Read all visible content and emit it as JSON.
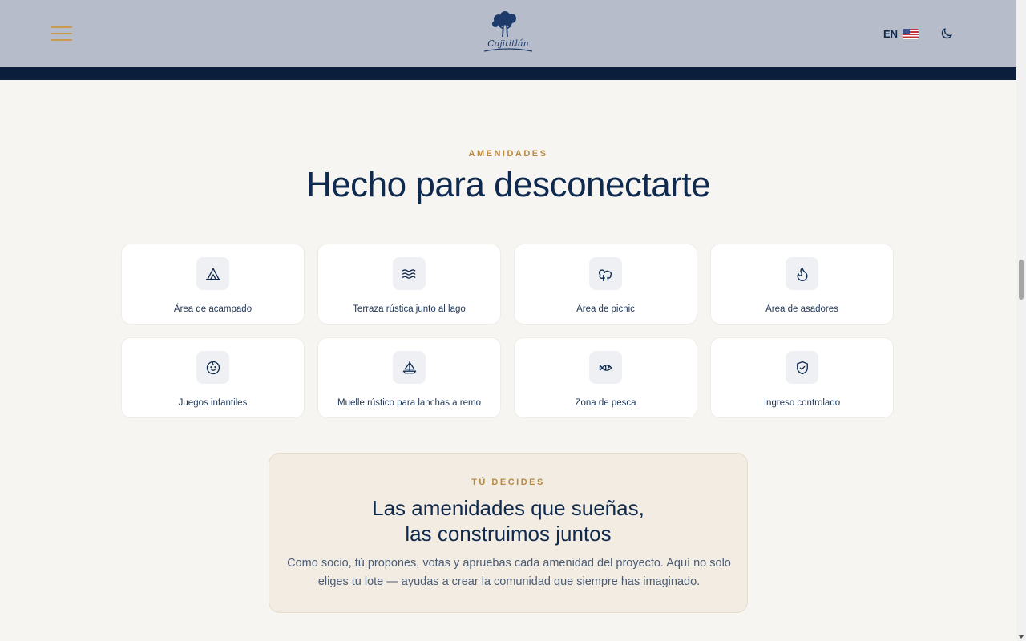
{
  "header": {
    "language_label": "EN",
    "logo_text": "Cajititlán",
    "colors": {
      "header_bg": "#b6bcc9",
      "header_bar": "#0b1f3d",
      "accent": "#c99a4b"
    }
  },
  "amenities": {
    "eyebrow": "AMENIDADES",
    "title": "Hecho para desconectarte",
    "items": [
      {
        "label": "Área de acampado",
        "icon": "tent-icon"
      },
      {
        "label": "Terraza rústica junto al lago",
        "icon": "waves-icon"
      },
      {
        "label": "Área de picnic",
        "icon": "trees-icon"
      },
      {
        "label": "Área de asadores",
        "icon": "flame-icon"
      },
      {
        "label": "Juegos infantiles",
        "icon": "baby-icon"
      },
      {
        "label": "Muelle rústico para lanchas a remo",
        "icon": "sailboat-icon"
      },
      {
        "label": "Zona de pesca",
        "icon": "fish-icon"
      },
      {
        "label": "Ingreso controlado",
        "icon": "shield-check-icon"
      }
    ]
  },
  "cta": {
    "eyebrow": "TÚ DECIDES",
    "title_line1": "Las amenidades que sueñas,",
    "title_line2": "las construimos juntos",
    "description": "Como socio, tú propones, votas y apruebas cada amenidad del proyecto. Aquí no solo eliges tu lote — ayudas a crear la comunidad que siempre has imaginado."
  }
}
